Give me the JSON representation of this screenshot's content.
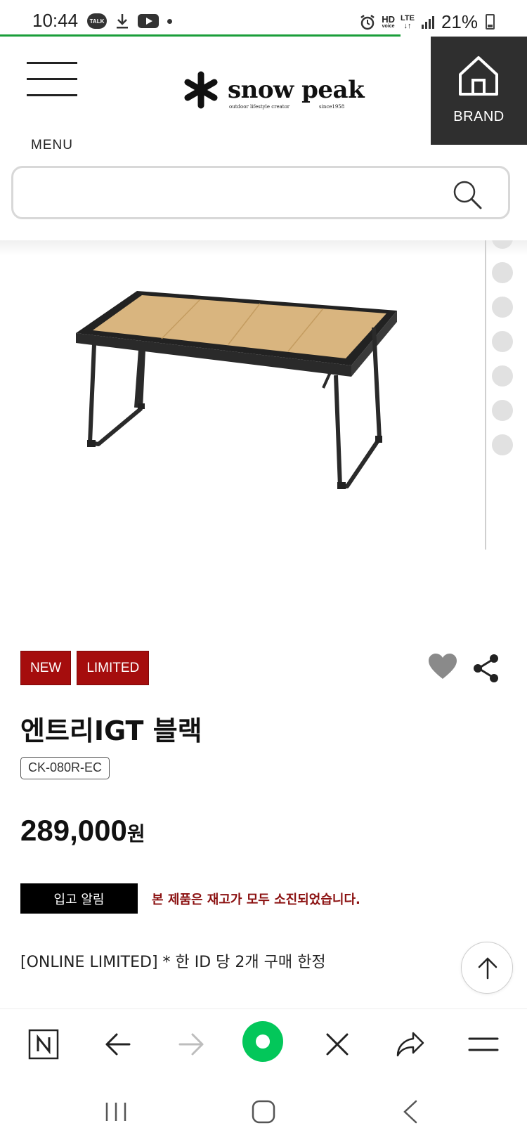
{
  "status_bar": {
    "time": "10:44",
    "talk_label": "TALK",
    "hd": "HD",
    "voice": "voice",
    "lte": "LTE",
    "battery": "21%"
  },
  "header": {
    "menu_label": "MENU",
    "logo_text": "snow peak",
    "logo_sub": "outdoor lifestyle creator",
    "logo_since": "since1958",
    "brand_label": "BRAND"
  },
  "search": {
    "placeholder": ""
  },
  "product": {
    "badges": [
      "NEW",
      "LIMITED"
    ],
    "name": "엔트리IGT 블랙",
    "code": "CK-080R-EC",
    "price": "289,000",
    "price_unit": "원",
    "restock_button": "입고 알림",
    "soldout_message": "본 제품은 재고가 모두 소진되었습니다.",
    "notice": "[ONLINE LIMITED] * 한 ID 당 2개 구매 한정"
  },
  "colors": {
    "badge_red": "#a50d0d",
    "soldout_red": "#8b1010",
    "brand_bg": "#2f2f2f",
    "loading_green": "#1a9e3a",
    "naver_green": "#03c75a"
  },
  "icons": {
    "menu": "hamburger-icon",
    "brand": "home-icon",
    "search": "search-icon",
    "like": "heart-icon",
    "share": "share-icon",
    "top": "arrow-up-icon",
    "browser": [
      "naver-n-icon",
      "back-arrow-icon",
      "forward-arrow-icon",
      "green-dot-icon",
      "close-icon",
      "share-forward-icon",
      "menu-lines-icon"
    ],
    "system_nav": [
      "recent-apps-icon",
      "home-square-icon",
      "back-chevron-icon"
    ]
  }
}
